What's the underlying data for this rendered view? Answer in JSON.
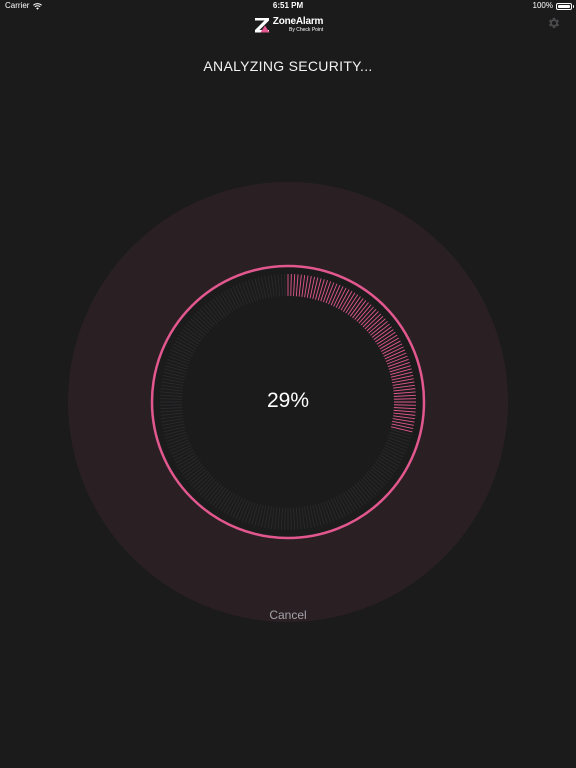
{
  "status_bar": {
    "carrier": "Carrier",
    "time": "6:51 PM",
    "battery_text": "100%"
  },
  "logo": {
    "name": "ZoneAlarm",
    "sub": "By Check Point"
  },
  "icons": {
    "wifi": "wifi-icon",
    "battery": "battery-icon",
    "settings": "gear-icon",
    "logo_mark": "zonealarm-z-icon"
  },
  "scan": {
    "title": "ANALYZING SECURITY...",
    "percent_text": "29%",
    "progress": 0.29,
    "cancel_label": "Cancel"
  },
  "colors": {
    "background": "#1b1b1c",
    "halo": "#2a2023",
    "accent": "#e2588e",
    "tick_inactive": "#2a2a2b"
  }
}
